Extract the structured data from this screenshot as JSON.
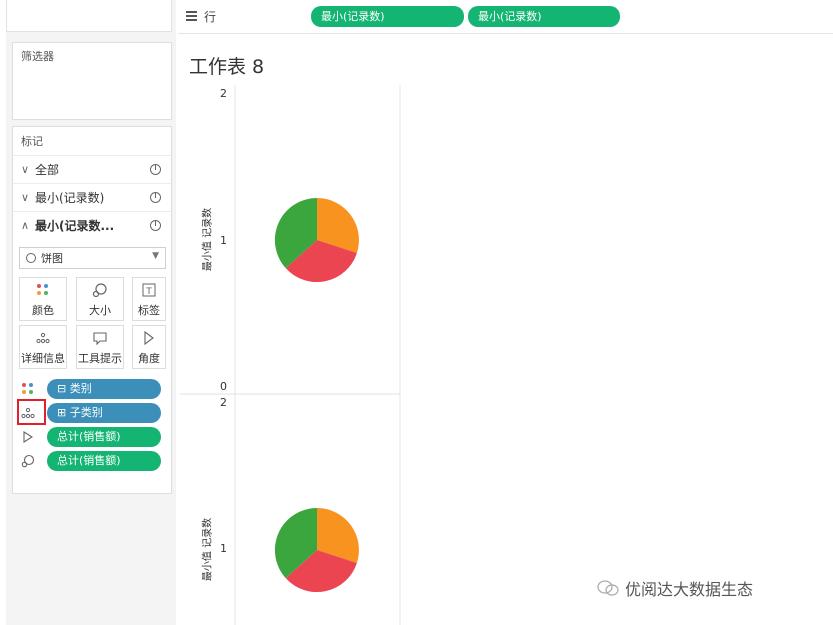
{
  "shelf": {
    "rows_label": "行",
    "pills": [
      "最小(记录数)",
      "最小(记录数)"
    ]
  },
  "filters": {
    "title": "筛选器"
  },
  "marks": {
    "title": "标记",
    "rows": [
      {
        "label": "全部",
        "chevron": "∨",
        "bold": false
      },
      {
        "label": "最小(记录数)",
        "chevron": "∨",
        "bold": false
      },
      {
        "label": "最小(记录数...",
        "chevron": "∧",
        "bold": true
      }
    ],
    "mark_type": "饼图",
    "tiles": [
      {
        "label": "颜色",
        "icon": "color-dots-icon"
      },
      {
        "label": "大小",
        "icon": "size-icon"
      },
      {
        "label": "标签",
        "icon": "label-icon"
      },
      {
        "label": "详细信息",
        "icon": "detail-icon"
      },
      {
        "label": "工具提示",
        "icon": "tooltip-icon"
      },
      {
        "label": "角度",
        "icon": "angle-icon"
      }
    ],
    "pills": [
      {
        "label": "⊟ 类别",
        "color": "blue",
        "icon": "color-dots-icon"
      },
      {
        "label": "⊞ 子类别",
        "color": "blue",
        "icon": "detail-icon"
      },
      {
        "label": "总计(销售额)",
        "color": "green",
        "icon": "angle-icon"
      },
      {
        "label": "总计(销售额)",
        "color": "green",
        "icon": "size-icon"
      }
    ]
  },
  "worksheet": {
    "title": "工作表 8",
    "panes": [
      {
        "axis_label": "最小值 记录数",
        "ticks": [
          "2",
          "1",
          "0"
        ]
      },
      {
        "axis_label": "最小值 记录数",
        "ticks": [
          "2",
          "1"
        ]
      }
    ]
  },
  "watermark": "优阅达大数据生态",
  "colors": {
    "pie_orange": "#f7931e",
    "pie_red": "#ec4552",
    "pie_green": "#3ba63e",
    "pill_green": "#14b573",
    "pill_blue": "#3b8fb8"
  }
}
